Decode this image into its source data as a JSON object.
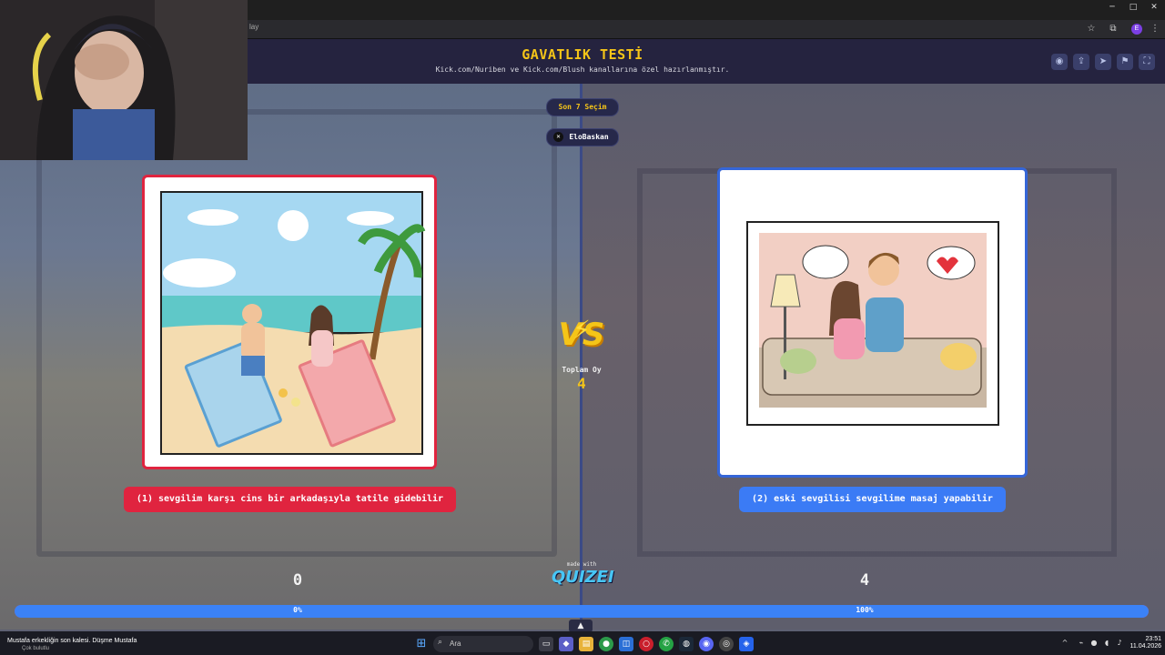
{
  "browser": {
    "url_fragment": "lay",
    "window_controls": [
      "─",
      "□",
      "✕"
    ],
    "toolbar_icons": [
      "☆",
      "⧉",
      "⋮"
    ],
    "profile_initial": "E"
  },
  "header": {
    "title": "GAVATLIK TESTİ",
    "subtitle": "Kick.com/Nuriben ve Kick.com/Blush kanallarına özel hazırlanmıştır.",
    "icons": [
      "eye-icon",
      "share-icon",
      "send-icon",
      "flag-icon",
      "fullscreen-icon"
    ],
    "icon_glyphs": [
      "◉",
      "⇪",
      "➤",
      "⚑",
      "⛶"
    ]
  },
  "center": {
    "last_selections": "Son 7 Seçim",
    "user_badge": "EloBaskan",
    "vs_text": "VS",
    "total_votes_label": "Toplam Oy",
    "total_votes_value": "4",
    "made_with": "made with",
    "logo_text": "QUIZEI"
  },
  "options": {
    "left": {
      "label": "(1) sevgilim karşı cins bir arkadaşıyla tatile gidebilir",
      "votes": "0",
      "percent": "0%",
      "accent": "#e0243f"
    },
    "right": {
      "label": "(2) eski sevgilisi sevgilime masaj yapabilir",
      "votes": "4",
      "percent": "100%",
      "accent": "#3b7bf5"
    }
  },
  "progress": {
    "right_fraction": 1.0
  },
  "taskbar": {
    "weather_title": "Mustafa erkekliğin son kalesi. Düşme Mustafa",
    "weather_sub": "Çok bulutlu",
    "search_placeholder": "Ara",
    "time": "23:51",
    "date": "11.04.2026"
  }
}
